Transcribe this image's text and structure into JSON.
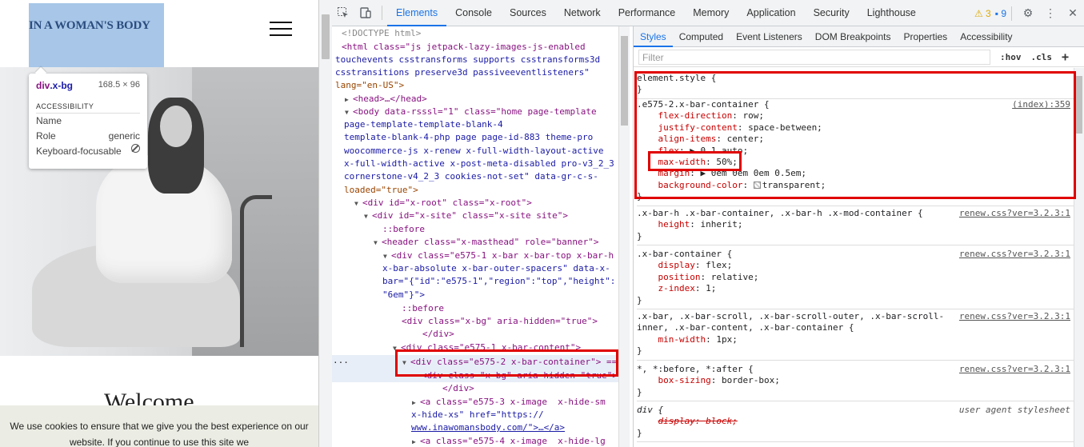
{
  "site": {
    "logo": "IN A WOMAN'S BODY",
    "welcome": "Welcome",
    "cookie_text": "We use cookies to ensure that we give you the best experience on our website. If you continue to use this site we"
  },
  "tooltip": {
    "selector_tag": "div",
    "selector_class": ".x-bg",
    "size": "168.5 × 96",
    "section": "ACCESSIBILITY",
    "rows": [
      {
        "label": "Name",
        "value": ""
      },
      {
        "label": "Role",
        "value": "generic"
      },
      {
        "label": "Keyboard-focusable",
        "value": ""
      }
    ]
  },
  "devtools": {
    "tabs": [
      "Elements",
      "Console",
      "Sources",
      "Network",
      "Performance",
      "Memory",
      "Application",
      "Security",
      "Lighthouse"
    ],
    "active_tab": "Elements",
    "warnings_count": "3",
    "messages_count": "9"
  },
  "elements": {
    "lines": [
      {
        "t": "<!DOCTYPE html>"
      },
      {
        "t": "<html class=\"js jetpack-lazy-images-js-enabled"
      },
      {
        "t": "touchevents csstransforms supports csstransforms3d"
      },
      {
        "t": "csstransitions preserve3d passiveeventlisteners\""
      },
      {
        "t": "lang=\"en-US\">"
      },
      {
        "t": "<head>…</head>"
      },
      {
        "t": "<body data-rsssl=\"1\" class=\"home page-template"
      },
      {
        "t": "page-template-template-blank-4"
      },
      {
        "t": "template-blank-4-php page page-id-883 theme-pro"
      },
      {
        "t": "woocommerce-js x-renew x-full-width-layout-active"
      },
      {
        "t": "x-full-width-active x-post-meta-disabled pro-v3_2_3"
      },
      {
        "t": "cornerstone-v4_2_3 cookies-not-set\" data-gr-c-s-"
      },
      {
        "t": "loaded=\"true\">"
      },
      {
        "t": "<div id=\"x-root\" class=\"x-root\">"
      },
      {
        "t": "<div id=\"x-site\" class=\"x-site site\">"
      },
      {
        "t": "::before"
      },
      {
        "t": "<header class=\"x-masthead\" role=\"banner\">"
      },
      {
        "t": "<div class=\"e575-1 x-bar x-bar-top x-bar-h"
      },
      {
        "t": "x-bar-absolute x-bar-outer-spacers\" data-x-"
      },
      {
        "t": "bar=\"{\"id\":\"e575-1\",\"region\":\"top\",\"height\":"
      },
      {
        "t": "\"6em\"}\">"
      },
      {
        "t": "::before"
      },
      {
        "t": "<div class=\"x-bg\" aria-hidden=\"true\">"
      },
      {
        "t": "</div>"
      },
      {
        "t": "<div class=\"e575-1 x-bar-content\">"
      },
      {
        "t": "<div class=\"e575-2 x-bar-container\"> =="
      },
      {
        "t": "<div class=\"x-bg\" aria-hidden=\"true\">"
      },
      {
        "t": "</div>"
      },
      {
        "t": "<a class=\"e575-3 x-image  x-hide-sm"
      },
      {
        "t": "x-hide-xs\" href=\"https://"
      },
      {
        "t": "www.inawomansbody.com/\">…</a>"
      },
      {
        "t": "<a class=\"e575-4 x-image  x-hide-lg"
      }
    ]
  },
  "styles": {
    "tabs": [
      "Styles",
      "Computed",
      "Event Listeners",
      "DOM Breakpoints",
      "Properties",
      "Accessibility"
    ],
    "active_tab": "Styles",
    "filter_placeholder": "Filter",
    "hov": ":hov",
    "cls": ".cls",
    "plus": "+",
    "element_style": "element.style {",
    "close_brace": "}",
    "rules": [
      {
        "selector": ".e575-2.x-bar-container {",
        "src": "(index):359",
        "props": [
          {
            "p": "flex-direction",
            "v": "row;"
          },
          {
            "p": "justify-content",
            "v": "space-between;"
          },
          {
            "p": "align-items",
            "v": "center;"
          },
          {
            "p": "flex",
            "v": "▶ 0 1 auto;"
          },
          {
            "p": "max-width",
            "v": "50%;"
          },
          {
            "p": "margin",
            "v": "▶ 0em 0em 0em 0.5em;"
          },
          {
            "p": "background-color",
            "v": "transparent;"
          }
        ]
      },
      {
        "selector": ".x-bar-h .x-bar-container, .x-bar-h .x-mod-container {",
        "src": "renew.css?ver=3.2.3:1",
        "props": [
          {
            "p": "height",
            "v": "inherit;"
          }
        ]
      },
      {
        "selector": ".x-bar-container {",
        "src": "renew.css?ver=3.2.3:1",
        "props": [
          {
            "p": "display",
            "v": "flex;"
          },
          {
            "p": "position",
            "v": "relative;"
          },
          {
            "p": "z-index",
            "v": "1;"
          }
        ]
      },
      {
        "selector": ".x-bar, .x-bar-scroll, .x-bar-scroll-outer, .x-bar-scroll-",
        "selector2": "inner, .x-bar-content, .x-bar-container {",
        "src": "renew.css?ver=3.2.3:1",
        "props": [
          {
            "p": "min-width",
            "v": "1px;"
          }
        ]
      },
      {
        "selector": "*, *:before, *:after {",
        "src": "renew.css?ver=3.2.3:1",
        "props": [
          {
            "p": "box-sizing",
            "v": "border-box;"
          }
        ]
      },
      {
        "selector": "div {",
        "src": "user agent stylesheet",
        "props": [
          {
            "p": "display",
            "v": "block;"
          }
        ]
      }
    ]
  }
}
